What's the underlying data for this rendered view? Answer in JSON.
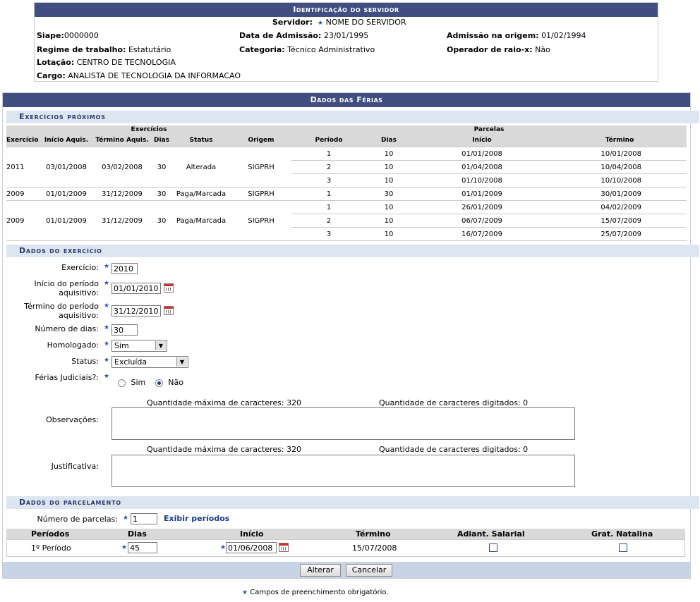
{
  "servidor": {
    "title": "Identificação do servidor",
    "servidor_label": "Servidor:",
    "servidor_value": "NOME DO SERVIDOR",
    "siape_label": "Siape:",
    "siape_value": "0000000",
    "admissao_label": "Data de Admissão:",
    "admissao_value": "23/01/1995",
    "admissao_origem_label": "Admissão na origem:",
    "admissao_origem_value": "01/02/1994",
    "regime_label": "Regime de trabalho:",
    "regime_value": "Estatutário",
    "categoria_label": "Categoria:",
    "categoria_value": "Técnico Administrativo",
    "raiox_label": "Operador de raio-x:",
    "raiox_value": "Não",
    "lotacao_label": "Lotação:",
    "lotacao_value": "CENTRO DE TECNOLOGIA",
    "cargo_label": "Cargo:",
    "cargo_value": "ANALISTA DE TECNOLOGIA DA INFORMACAO"
  },
  "ferias": {
    "title": "Dados das Férias",
    "proximos_title": "Exercícios próximos",
    "group_exercicios": "Exercícios",
    "group_parcelas": "Parcelas",
    "headers": [
      "Exercício",
      "Início Aquis.",
      "Término Aquis.",
      "Dias",
      "Status",
      "Origem",
      "Período",
      "Dias",
      "Início",
      "Término"
    ],
    "rows": [
      {
        "exercicio": "2011",
        "inicio": "03/01/2008",
        "termino": "03/02/2008",
        "dias": "30",
        "status": "Alterada",
        "origem": "SIGPRH",
        "parcelas": [
          {
            "periodo": "1",
            "dias": "10",
            "inicio": "01/01/2008",
            "termino": "10/01/2008"
          },
          {
            "periodo": "2",
            "dias": "10",
            "inicio": "01/04/2008",
            "termino": "10/04/2008"
          },
          {
            "periodo": "3",
            "dias": "10",
            "inicio": "01/10/2008",
            "termino": "10/10/2008"
          }
        ]
      },
      {
        "exercicio": "2009",
        "inicio": "01/01/2009",
        "termino": "31/12/2009",
        "dias": "30",
        "status": "Paga/Marcada",
        "origem": "SIGPRH",
        "parcelas": [
          {
            "periodo": "1",
            "dias": "30",
            "inicio": "01/01/2009",
            "termino": "30/01/2009"
          }
        ]
      },
      {
        "exercicio": "2009",
        "inicio": "01/01/2009",
        "termino": "31/12/2009",
        "dias": "30",
        "status": "Paga/Marcada",
        "origem": "SIGPRH",
        "parcelas": [
          {
            "periodo": "1",
            "dias": "10",
            "inicio": "26/01/2009",
            "termino": "04/02/2009"
          },
          {
            "periodo": "2",
            "dias": "10",
            "inicio": "06/07/2009",
            "termino": "15/07/2009"
          },
          {
            "periodo": "3",
            "dias": "10",
            "inicio": "16/07/2009",
            "termino": "25/07/2009"
          }
        ]
      }
    ]
  },
  "exercicio_form": {
    "title": "Dados do exercício",
    "exercicio_label": "Exercício:",
    "exercicio_value": "2010",
    "inicio_label_1": "Início do período",
    "inicio_label_2": "aquisitivo:",
    "inicio_value": "01/01/2010",
    "termino_label_1": "Término do período",
    "termino_label_2": "aquisitivo:",
    "termino_value": "31/12/2010",
    "numdias_label": "Número de dias:",
    "numdias_value": "30",
    "homologado_label": "Homologado:",
    "homologado_value": "Sim",
    "status_label": "Status:",
    "status_value": "Excluída",
    "judiciais_label": "Férias Judiciais?:",
    "sim_label": "Sim",
    "nao_label": "Não",
    "max_chars_text": "Quantidade máxima de caracteres: 320",
    "digitados_text": "Quantidade de caracteres digitados: 0",
    "observacoes_label": "Observações:",
    "justificativa_label": "Justificativa:"
  },
  "parcelamento": {
    "title": "Dados do parcelamento",
    "num_parcelas_label": "Número de parcelas:",
    "num_parcelas_value": "1",
    "exibir_link": "Exibir períodos",
    "headers": [
      "Períodos",
      "Dias",
      "Início",
      "Término",
      "Adiant. Salarial",
      "Grat. Natalina"
    ],
    "row": {
      "periodo": "1º Período",
      "dias": "45",
      "inicio": "01/06/2008",
      "termino": "15/07/2008"
    }
  },
  "buttons": {
    "alterar": "Alterar",
    "cancelar": "Cancelar"
  },
  "footer": {
    "obrigatorio": "Campos de preenchimento obrigatório."
  },
  "colors": {
    "header_bar": "#404e82",
    "section_bg": "#dde5f0",
    "accent": "#1d56b3"
  }
}
